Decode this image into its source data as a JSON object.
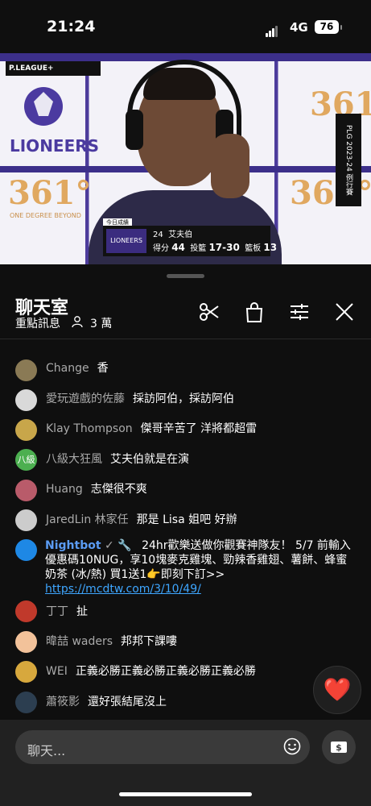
{
  "status_bar": {
    "time": "21:24",
    "network": "4G",
    "battery": "76"
  },
  "video": {
    "league_logo": "P.LEAGUE+",
    "team_logo": "LIONEERS",
    "sponsor": "361°",
    "sponsor_tag": "ONE DEGREE BEYOND",
    "side_tag": "PLG 2023-24 例行賽",
    "scoreboard": {
      "tag": "今日成績",
      "number": "24",
      "player": "艾夫伯",
      "points_label": "得分",
      "points": "44",
      "fg_label": "投籃",
      "fg": "17-30",
      "reb_label": "籃板",
      "reb": "13"
    }
  },
  "chat_header": {
    "title": "聊天室",
    "subtitle": "重點訊息",
    "viewers": "3 萬",
    "icons": [
      "scissors-icon",
      "shopping-bag-icon",
      "filter-icon",
      "close-icon"
    ]
  },
  "messages": [
    {
      "author": "Change",
      "text": "香",
      "avatar_color": "#8a7a55"
    },
    {
      "author": "愛玩遊戲的佐藤",
      "text": "採訪阿伯，採訪阿伯",
      "avatar_color": "#d9d9d9"
    },
    {
      "author": "Klay Thompson",
      "text": "傑哥辛苦了 洋將都超雷",
      "avatar_color": "#c8a64a"
    },
    {
      "author": "八級大狂風",
      "text": "艾夫伯就是在演",
      "avatar_color": "#4caf50",
      "avatar_text": "八級"
    },
    {
      "author": "Huang",
      "text": "志傑很不爽",
      "avatar_color": "#b95b6a"
    },
    {
      "author": "JaredLin 林家任",
      "text": "那是 Lisa 姐吧 好辦",
      "avatar_color": "#cccccc"
    }
  ],
  "nightbot": {
    "author": "Nightbot",
    "text": "24hr歡樂送做你觀賽神隊友！ 5/7 前輸入優惠碼10NUG，享10塊麥克雞塊、勁辣香雞翅、薯餅、蜂蜜奶茶 (冰/熱) 買1送1👉即刻下訂>>",
    "link": "https://mcdtw.com/3/10/49/"
  },
  "messages2": [
    {
      "author": "丁丁",
      "text": "扯",
      "avatar_color": "#c0392b"
    },
    {
      "author": "暐喆 waders",
      "text": "邦邦下課嘍",
      "avatar_color": "#f2c29a"
    },
    {
      "author": "WEI",
      "text": "正義必勝正義必勝正義必勝正義必勝",
      "avatar_color": "#d7a83d"
    },
    {
      "author": "蕭筱影",
      "text": "還好張結尾沒上",
      "avatar_color": "#2c3e50"
    }
  ],
  "input": {
    "placeholder": "聊天..."
  },
  "colors": {
    "background": "#0f0f0f",
    "bottom_bar": "#212121",
    "link": "#3ea6ff",
    "heart": "#ff2d2d"
  }
}
